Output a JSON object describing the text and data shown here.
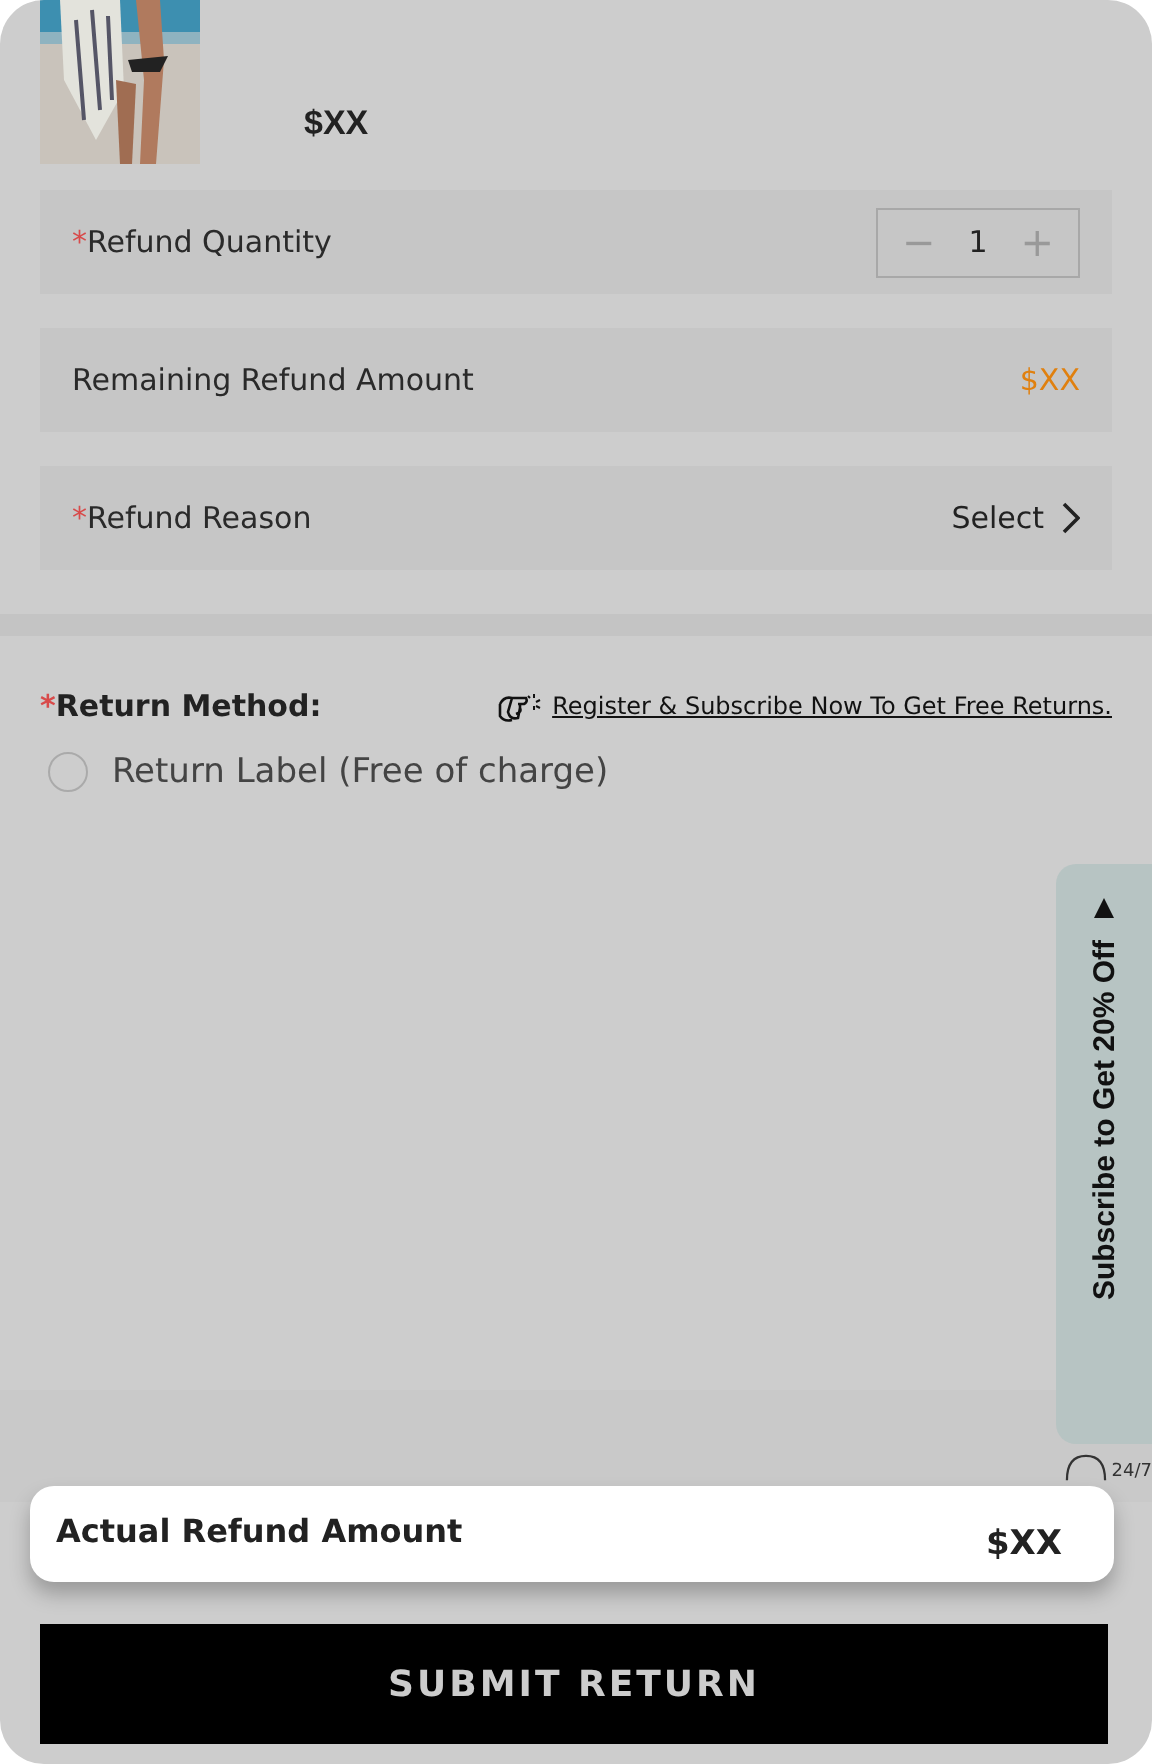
{
  "product": {
    "kind": "picture",
    "price": "$XX"
  },
  "fields": [
    {
      "kind": "stepper",
      "label": "Refund Quantity",
      "required_mark": "*",
      "value": "1",
      "minus": "−",
      "plus": "+"
    },
    {
      "kind": "amount",
      "label": "Remaining Refund Amount",
      "value": "$XX"
    },
    {
      "kind": "select",
      "label": "Refund Reason",
      "required_mark": "*",
      "value": "Select"
    }
  ],
  "return_method": {
    "label": "Return Method:",
    "required_mark": "*",
    "promo_link": "Register & Subscribe Now To Get Free Returns.",
    "options": [
      {
        "label": "Return Label (Free of charge)",
        "selected": false
      }
    ]
  },
  "subscribe_tab": {
    "label": "Subscribe to Get 20% Off"
  },
  "support": {
    "label": "24/7"
  },
  "summary": {
    "label": "Actual Refund Amount",
    "value": "$XX"
  },
  "submit_button": "SUBMIT RETURN"
}
